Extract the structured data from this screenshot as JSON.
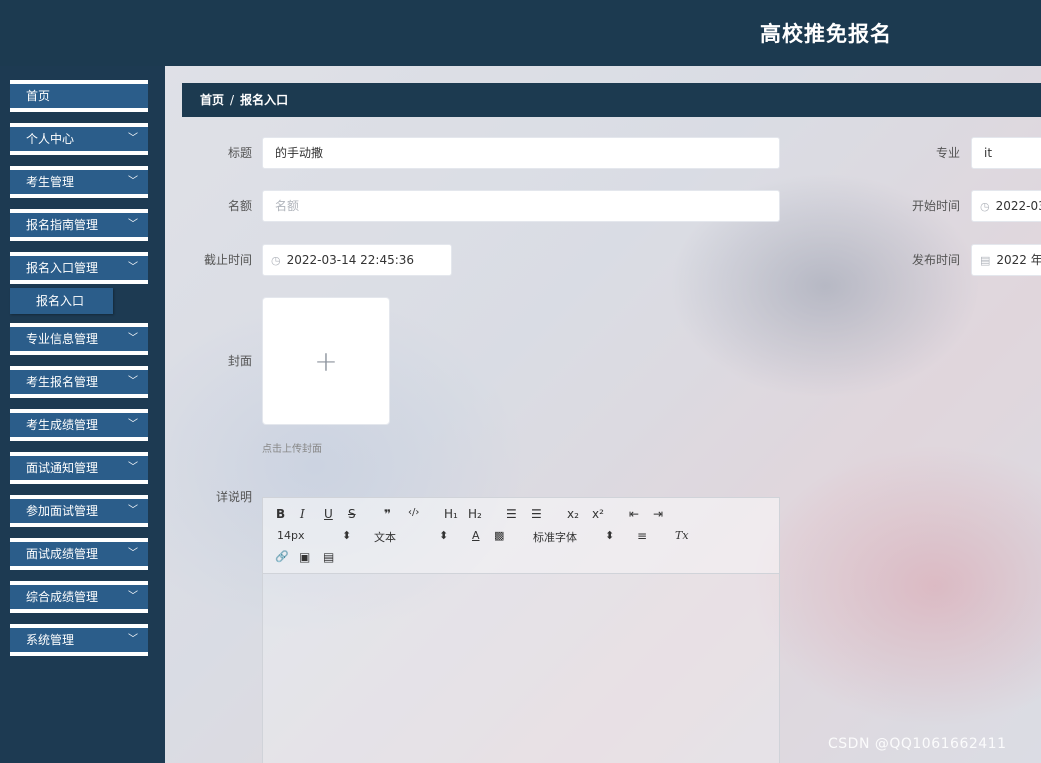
{
  "header": {
    "title": "高校推免报名"
  },
  "sidebar": {
    "items": [
      {
        "label": "首页",
        "has_arrow": false
      },
      {
        "label": "个人中心",
        "has_arrow": true
      },
      {
        "label": "考生管理",
        "has_arrow": true
      },
      {
        "label": "报名指南管理",
        "has_arrow": true
      },
      {
        "label": "报名入口管理",
        "has_arrow": true
      },
      {
        "label": "专业信息管理",
        "has_arrow": true
      },
      {
        "label": "考生报名管理",
        "has_arrow": true
      },
      {
        "label": "考生成绩管理",
        "has_arrow": true
      },
      {
        "label": "面试通知管理",
        "has_arrow": true
      },
      {
        "label": "参加面试管理",
        "has_arrow": true
      },
      {
        "label": "面试成绩管理",
        "has_arrow": true
      },
      {
        "label": "综合成绩管理",
        "has_arrow": true
      },
      {
        "label": "系统管理",
        "has_arrow": true
      }
    ],
    "subitem": {
      "label": "报名入口"
    },
    "arrow_glyph": "﹀"
  },
  "breadcrumb": {
    "home": "首页",
    "separator": "/",
    "current": "报名入口"
  },
  "form": {
    "title_label": "标题",
    "title_value": "的手动撒",
    "quota_label": "名额",
    "quota_placeholder": "名额",
    "deadline_label": "截止时间",
    "deadline_value": "2022-03-14 22:45:36",
    "major_label": "专业",
    "major_value": "it",
    "start_label": "开始时间",
    "start_value": "2022-03",
    "publish_label": "发布时间",
    "publish_value": "2022 年",
    "cover_label": "封面",
    "cover_plus": "+",
    "cover_hint": "点击上传封面",
    "detail_label": "详说明"
  },
  "editor_toolbar": {
    "bold": "B",
    "italic": "I",
    "underline": "U",
    "strike": "S",
    "quote": "❞",
    "code": "‹/›",
    "h1": "H₁",
    "h2": "H₂",
    "ordered_list": "☰",
    "bullet_list": "☰",
    "subscript": "x₂",
    "superscript": "x²",
    "indent_left": "⇤",
    "indent_right": "⇥",
    "size": "14px",
    "format": "文本",
    "font_color": "A",
    "background": "▩",
    "font_family": "标准字体",
    "align": "≡",
    "clear": "Tx",
    "link": "🔗",
    "image": "▣",
    "video": "▤",
    "select_caret": "⬍"
  },
  "watermark": "CSDN @QQ1061662411",
  "colors": {
    "sidebar_bg": "#1d3a52",
    "menu_item": "#2b5d8a",
    "header_bg": "#1c3a50"
  }
}
